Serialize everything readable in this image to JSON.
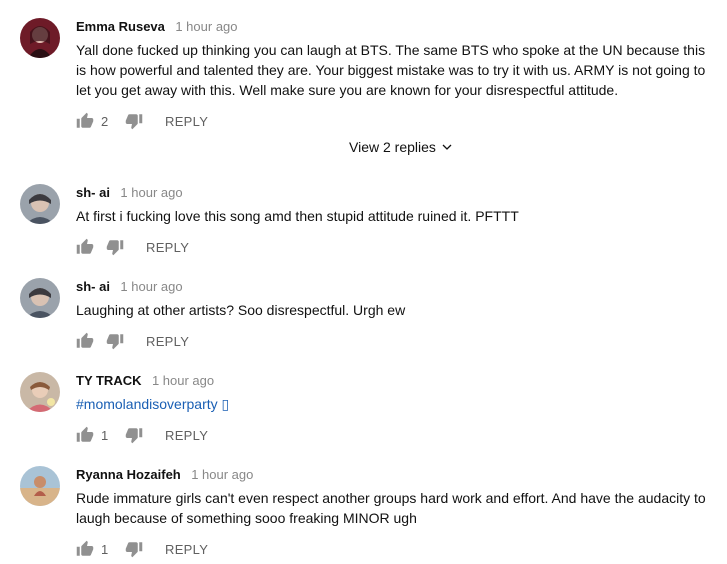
{
  "comments": [
    {
      "author": "Emma Ruseva",
      "time": "1 hour ago",
      "text": "Yall done fucked up thinking you can laugh at BTS. The same BTS who spoke at the UN because this is how powerful and talented they are. Your biggest mistake was to try it with us. ARMY is not going to let you get away with this. Well make sure you are known for your disrespectful attitude.",
      "likes": "2",
      "reply_label": "REPLY",
      "view_replies": "View 2 replies"
    },
    {
      "author": "sh- ai",
      "time": "1 hour ago",
      "text": "At first i fucking love this song amd then stupid attitude ruined it. PFTTT",
      "likes": "",
      "reply_label": "REPLY"
    },
    {
      "author": "sh- ai",
      "time": "1 hour ago",
      "text": "Laughing at other artists? Soo disrespectful. Urgh ew",
      "likes": "",
      "reply_label": "REPLY"
    },
    {
      "author": "TY TRACK",
      "time": "1 hour ago",
      "text": "#momolandisoverparty ▯",
      "likes": "1",
      "reply_label": "REPLY"
    },
    {
      "author": "Ryanna Hozaifeh",
      "time": "1 hour ago",
      "text": "Rude immature girls  can't even respect another groups hard work and effort. And have the audacity to laugh because of something sooo freaking MINOR ugh",
      "likes": "1",
      "reply_label": "REPLY"
    }
  ],
  "colors": {
    "author": "#111111",
    "meta": "#888888",
    "action": "#606060",
    "hashtag": "#1a5fb4"
  },
  "icons": {
    "like": "thumbs-up-icon",
    "dislike": "thumbs-down-icon",
    "expand": "chevron-down-icon"
  }
}
